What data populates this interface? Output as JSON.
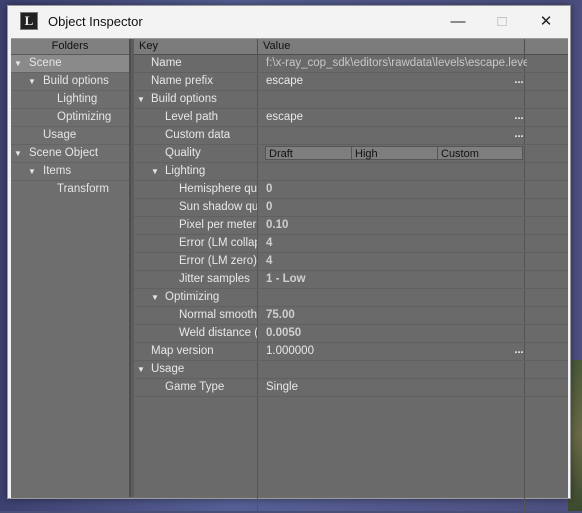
{
  "window": {
    "title": "Object Inspector",
    "icon_letter": "L"
  },
  "folders": {
    "header": "Folders",
    "items": [
      {
        "label": "Scene",
        "selected": true
      },
      {
        "label": "Build options"
      },
      {
        "label": "Lighting"
      },
      {
        "label": "Optimizing"
      },
      {
        "label": "Usage"
      },
      {
        "label": "Scene Object"
      },
      {
        "label": "Items"
      },
      {
        "label": "Transform"
      }
    ]
  },
  "props": {
    "key_header": "Key",
    "value_header": "Value",
    "rows": [
      {
        "key": "Name",
        "value": "f:\\x-ray_cop_sdk\\editors\\rawdata\\levels\\escape.level"
      },
      {
        "key": "Name prefix",
        "value": "escape"
      },
      {
        "key": "Build options",
        "value": ""
      },
      {
        "key": "Level path",
        "value": "escape"
      },
      {
        "key": "Custom data",
        "value": ""
      },
      {
        "key": "Quality",
        "value": ""
      },
      {
        "key": "Lighting",
        "value": ""
      },
      {
        "key": "Hemisphere qua",
        "value": "0"
      },
      {
        "key": "Sun shadow qua",
        "value": "0"
      },
      {
        "key": "Pixel per meter",
        "value": "0.10"
      },
      {
        "key": "Error (LM collaps",
        "value": "4"
      },
      {
        "key": "Error (LM zero)",
        "value": "4"
      },
      {
        "key": "Jitter samples",
        "value": "1 - Low"
      },
      {
        "key": "Optimizing",
        "value": ""
      },
      {
        "key": "Normal smooth a",
        "value": "75.00"
      },
      {
        "key": "Weld distance (r",
        "value": "0.0050"
      },
      {
        "key": "Map version",
        "value": "1.000000"
      },
      {
        "key": "Usage",
        "value": ""
      },
      {
        "key": "Game Type",
        "value": "Single"
      }
    ],
    "quality_options": [
      "Draft",
      "High",
      "Custom"
    ],
    "ellipsis": "..."
  }
}
